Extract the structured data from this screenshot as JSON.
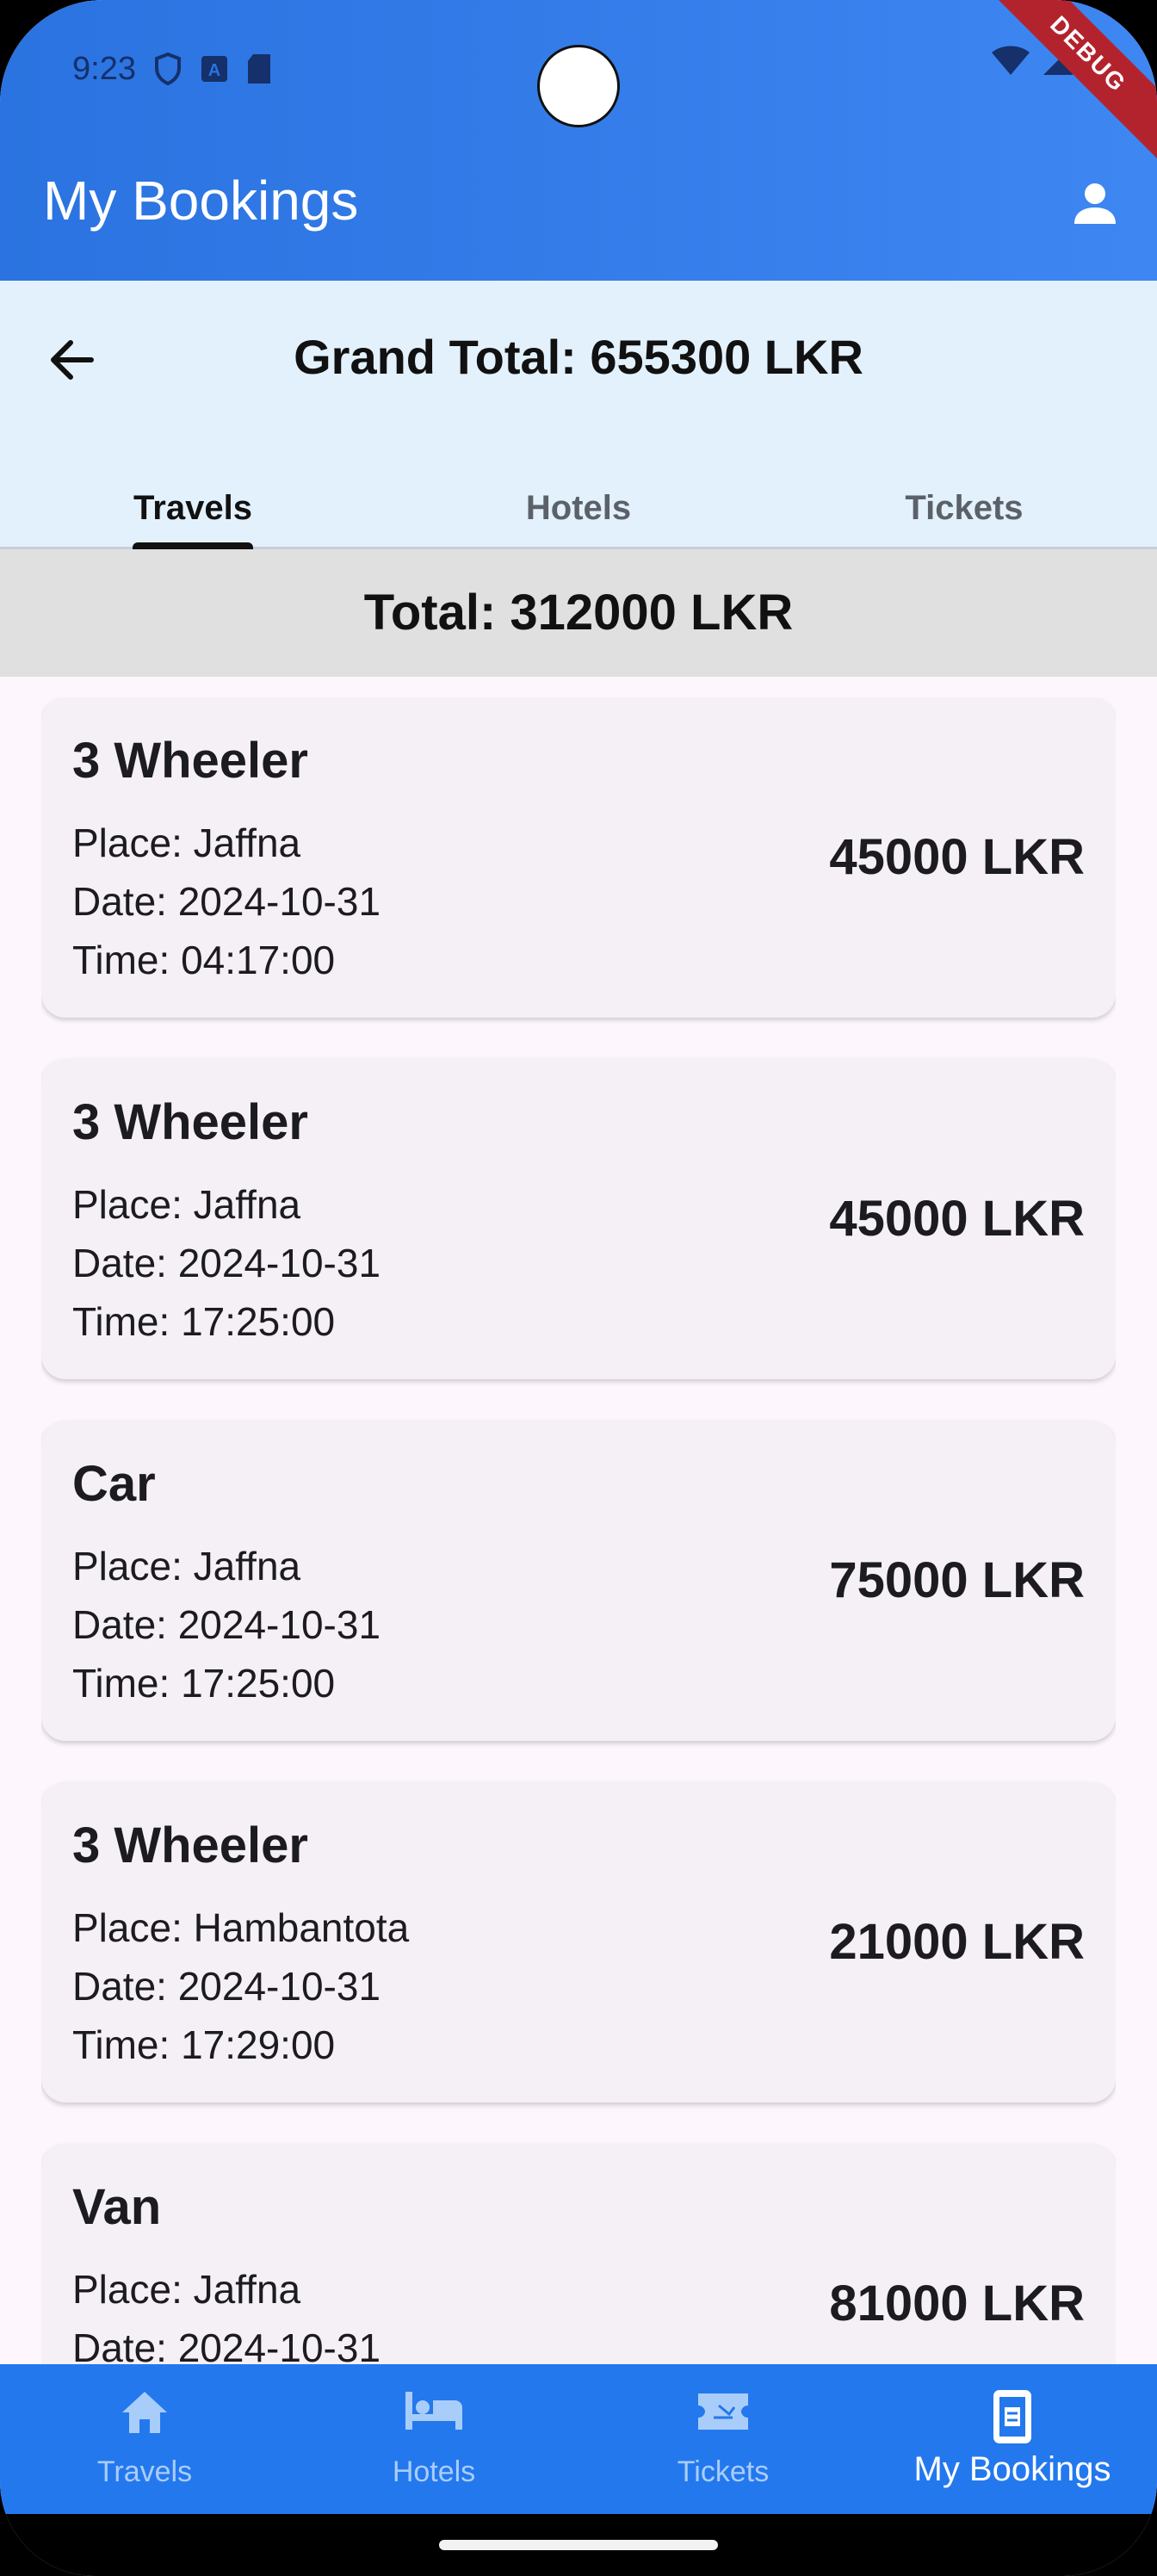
{
  "status_bar": {
    "time": "9:23",
    "debug_label": "DEBUG"
  },
  "app_bar": {
    "title": "My Bookings"
  },
  "header": {
    "grand_total": "Grand Total: 655300 LKR"
  },
  "tabs": [
    {
      "label": "Travels",
      "active": true
    },
    {
      "label": "Hotels",
      "active": false
    },
    {
      "label": "Tickets",
      "active": false
    }
  ],
  "section_total": "Total: 312000 LKR",
  "bookings": [
    {
      "vehicle": "3 Wheeler",
      "place": "Place: Jaffna",
      "date": "Date: 2024-10-31",
      "time": "Time: 04:17:00",
      "price": "45000 LKR"
    },
    {
      "vehicle": "3 Wheeler",
      "place": "Place: Jaffna",
      "date": "Date: 2024-10-31",
      "time": "Time: 17:25:00",
      "price": "45000 LKR"
    },
    {
      "vehicle": "Car",
      "place": "Place: Jaffna",
      "date": "Date: 2024-10-31",
      "time": "Time: 17:25:00",
      "price": "75000 LKR"
    },
    {
      "vehicle": "3 Wheeler",
      "place": "Place: Hambantota",
      "date": "Date: 2024-10-31",
      "time": "Time: 17:29:00",
      "price": "21000 LKR"
    },
    {
      "vehicle": "Van",
      "place": "Place: Jaffna",
      "date": "Date: 2024-10-31",
      "time": "",
      "price": "81000 LKR"
    }
  ],
  "bottom_nav": [
    {
      "label": "Travels",
      "icon": "home-icon",
      "active": false
    },
    {
      "label": "Hotels",
      "icon": "bed-icon",
      "active": false
    },
    {
      "label": "Tickets",
      "icon": "ticket-icon",
      "active": false
    },
    {
      "label": "My Bookings",
      "icon": "booking-icon",
      "active": true
    }
  ],
  "colors": {
    "app_bar": "#2a73e0",
    "header_bg": "#e3f1fc",
    "total_bar_bg": "#e0e0e0",
    "card_bg": "#f5eff6",
    "bottom_nav_bg": "#2378ee",
    "debug_banner": "#b3232e"
  }
}
